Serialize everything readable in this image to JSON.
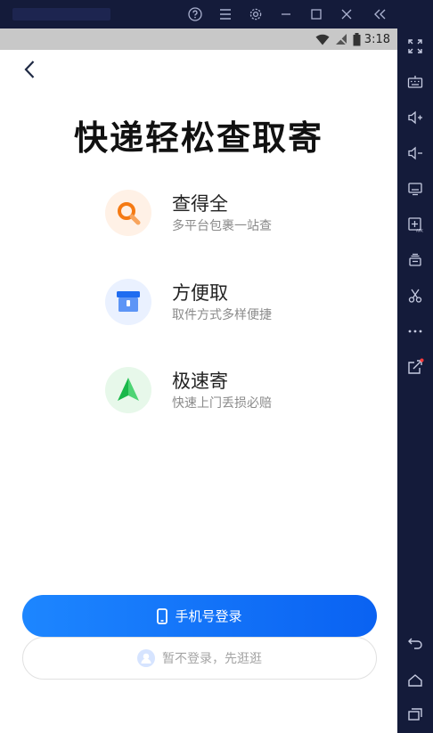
{
  "statusbar": {
    "time": "3:18"
  },
  "window": {
    "titlebar_icons": [
      "help-icon",
      "menu-icon",
      "settings-icon",
      "minimize-icon",
      "maximize-icon",
      "close-icon"
    ],
    "collapse_icon": "double-chevron-left-icon"
  },
  "sidebar": {
    "icons": [
      "fullscreen-icon",
      "keyboard-icon",
      "volume-up-icon",
      "volume-down-icon",
      "screen-icon",
      "apk-install-icon",
      "layers-icon",
      "scissors-icon",
      "more-icon",
      "share-icon",
      "back-icon",
      "home-icon",
      "recent-apps-icon"
    ]
  },
  "page": {
    "headline": "快递轻松查取寄",
    "features": [
      {
        "title": "查得全",
        "subtitle": "多平台包裹一站查",
        "icon": "magnifier-icon",
        "color": "#f57a13",
        "bg": "#fff1e6"
      },
      {
        "title": "方便取",
        "subtitle": "取件方式多样便捷",
        "icon": "parcel-box-icon",
        "color": "#1f6cf0",
        "bg": "#eaf1ff"
      },
      {
        "title": "极速寄",
        "subtitle": "快速上门丢损必赔",
        "icon": "paper-plane-icon",
        "color": "#19b84a",
        "bg": "#e7f8ea"
      }
    ],
    "primary_button": "手机号登录",
    "secondary_button": "暂不登录，先逛逛"
  },
  "colors": {
    "primary_blue": "#0a62f2",
    "emulator_dark": "#141b3a"
  }
}
